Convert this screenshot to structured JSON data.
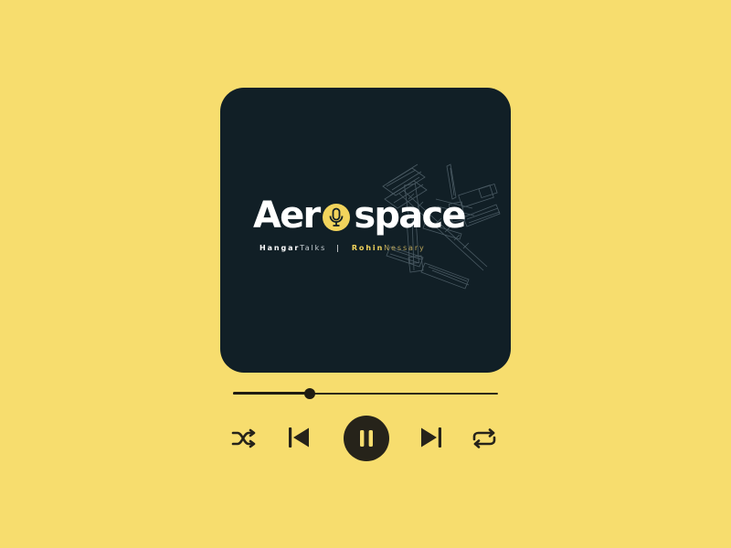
{
  "album": {
    "title_part1": "Aer",
    "title_part2": "space",
    "byline": {
      "show_bold": "Hangar",
      "show_light": "Talks",
      "separator": "|",
      "host_bold": "Rohin",
      "host_light": "Nessary"
    }
  },
  "player": {
    "progress_fraction": 0.29,
    "state": "playing"
  },
  "controls": [
    {
      "name": "shuffle-button",
      "icon": "shuffle-icon"
    },
    {
      "name": "previous-button",
      "icon": "skip-previous-icon"
    },
    {
      "name": "pause-button",
      "icon": "pause-icon"
    },
    {
      "name": "next-button",
      "icon": "skip-next-icon"
    },
    {
      "name": "repeat-button",
      "icon": "repeat-icon"
    }
  ],
  "colors": {
    "background": "#f7dd6e",
    "card": "#111f26",
    "accent": "#f2d45c",
    "controls": "#26231a"
  }
}
